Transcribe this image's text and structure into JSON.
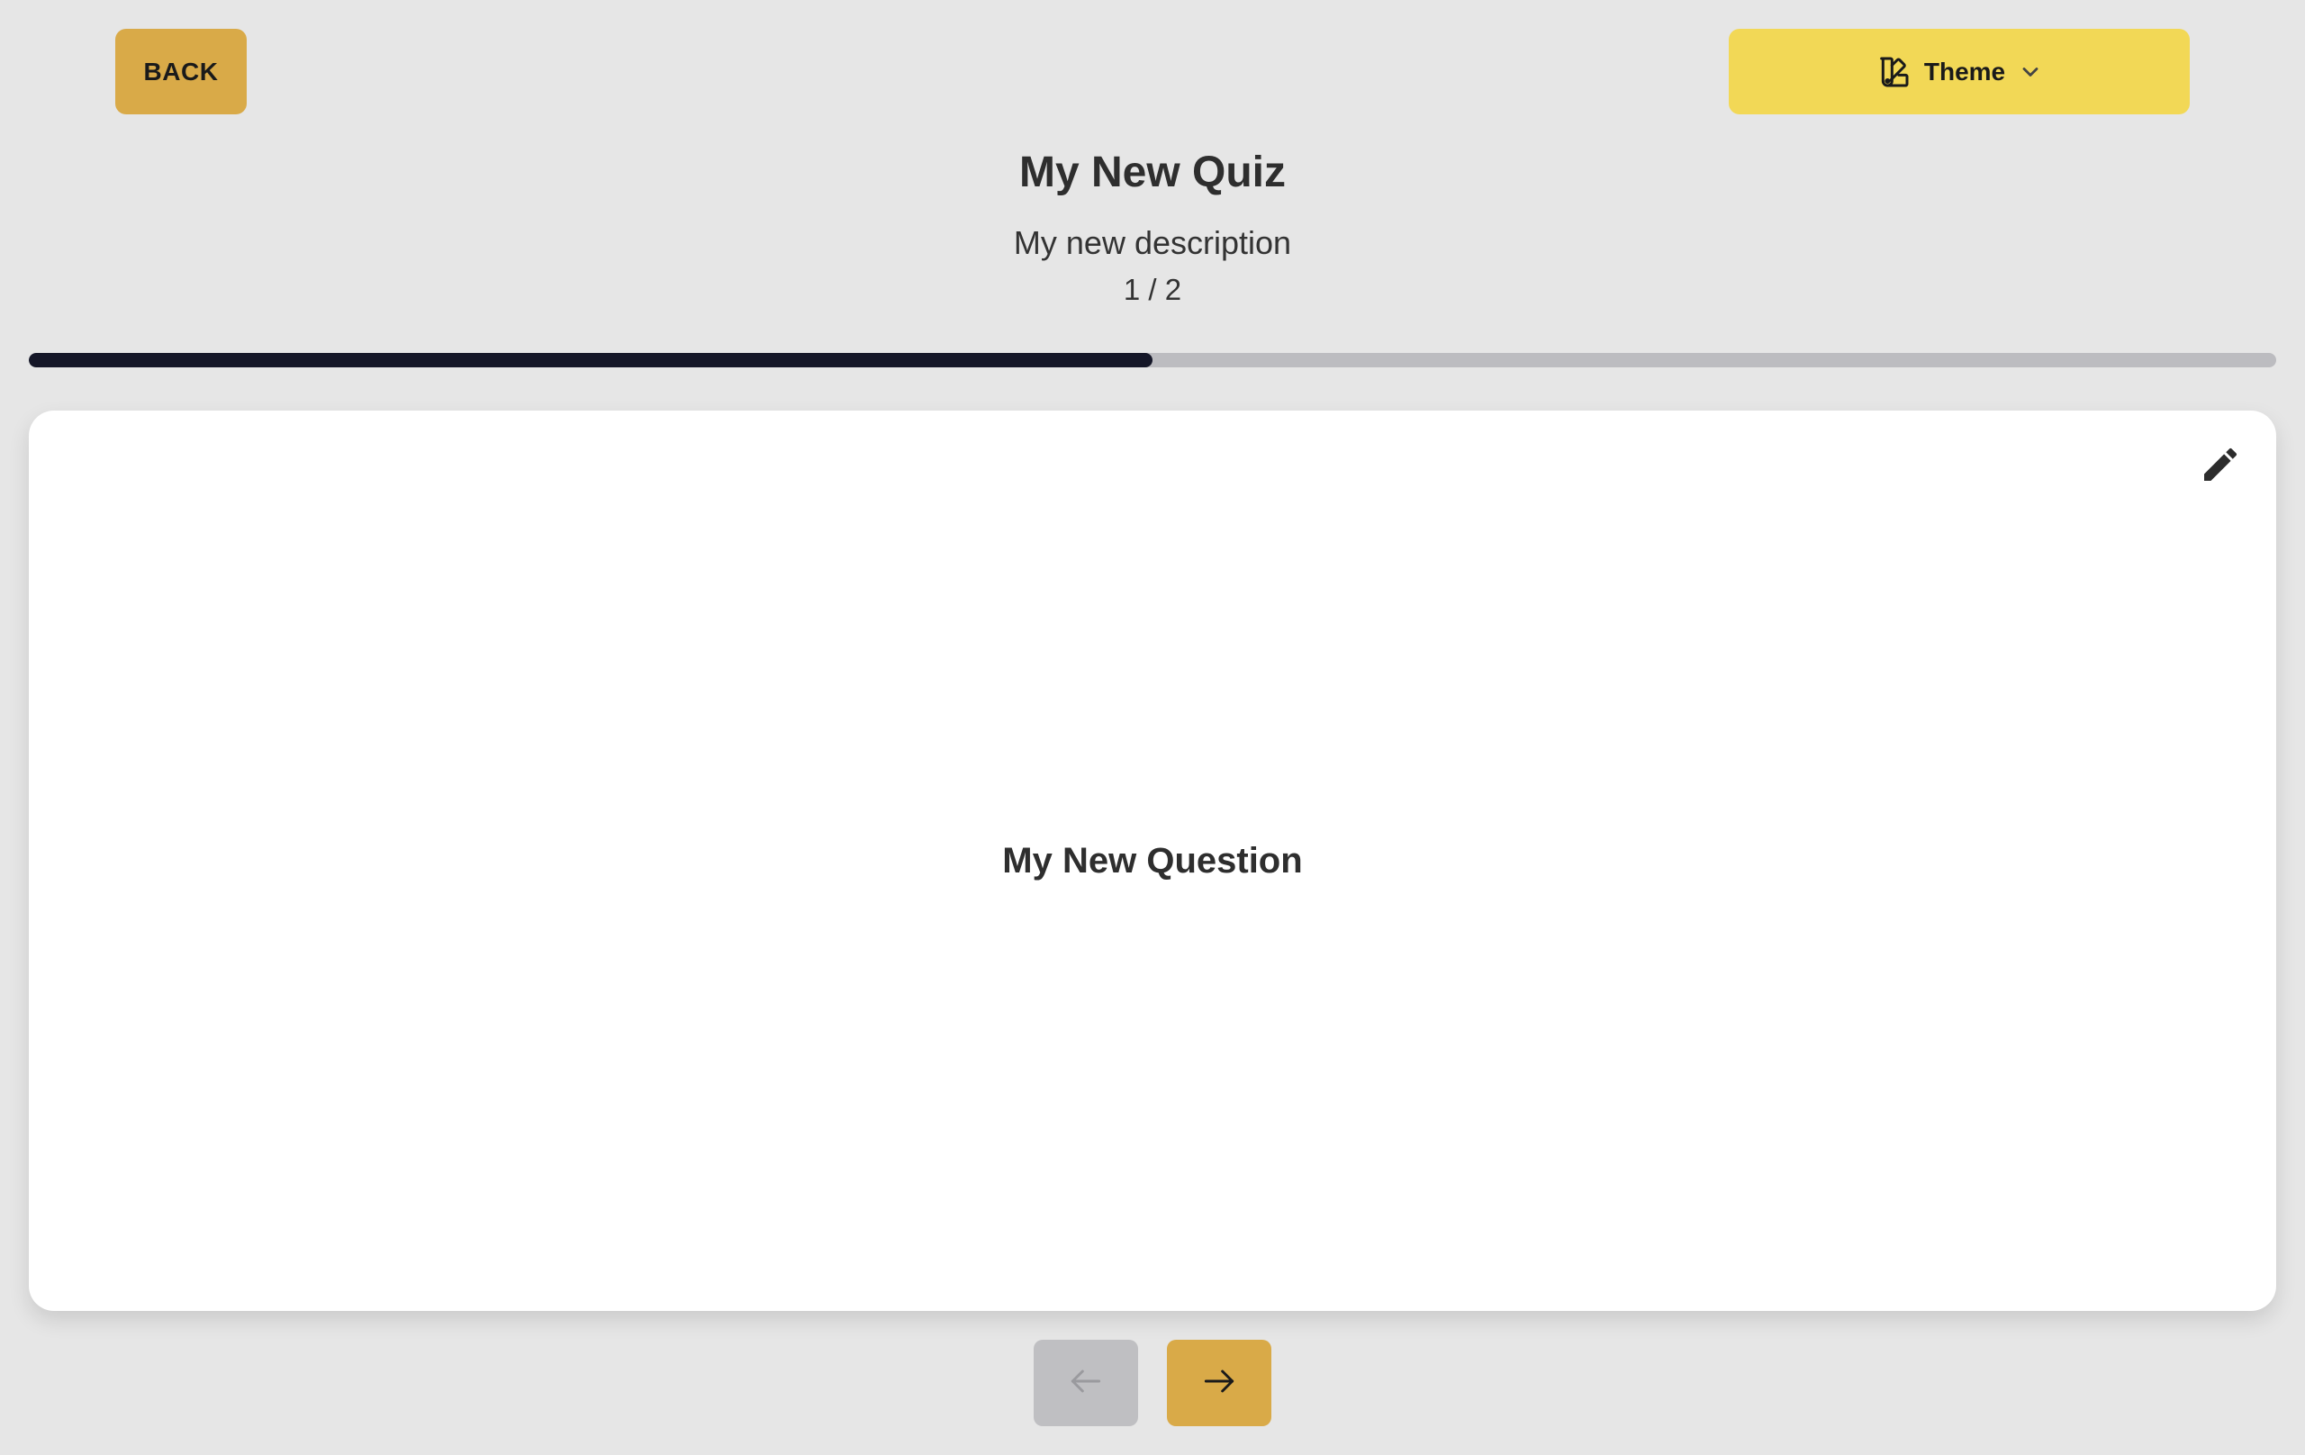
{
  "toolbar": {
    "back_label": "BACK",
    "theme_label": "Theme"
  },
  "quiz": {
    "title": "My New Quiz",
    "description": "My new description",
    "counter": "1 / 2",
    "progress_fraction": 0.5
  },
  "card": {
    "question": "My New Question"
  },
  "icons": {
    "theme": "palette-icon",
    "dropdown": "chevron-down-icon",
    "edit": "pencil-icon",
    "prev": "arrow-left-icon",
    "next": "arrow-right-icon"
  },
  "colors": {
    "background": "#e6e6e6",
    "back_button": "#d9aa48",
    "theme_button": "#f2d856",
    "progress_fill": "#151728",
    "progress_track": "#bcbcc0",
    "nav_prev_disabled": "#bfbfc2",
    "nav_next": "#d9aa48"
  }
}
